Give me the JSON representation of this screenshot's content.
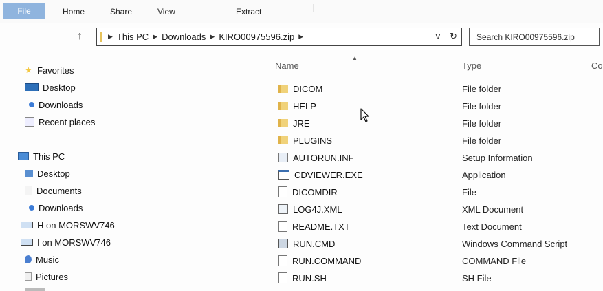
{
  "ribbon": {
    "tabs": [
      "File",
      "Home",
      "Share",
      "View",
      "Extract"
    ]
  },
  "address": {
    "crumbs": [
      "This PC",
      "Downloads",
      "KIRO00975596.zip"
    ],
    "dropdown_glyph": "v",
    "refresh_glyph": "↻"
  },
  "search": {
    "placeholder": "Search KIRO00975596.zip"
  },
  "nav": {
    "items": [
      {
        "label": "Favorites",
        "icon": "star-icon"
      },
      {
        "label": "Desktop",
        "icon": "desktop-icon"
      },
      {
        "label": "Downloads",
        "icon": "downloads-icon"
      },
      {
        "label": "Recent places",
        "icon": "recent-places-icon"
      },
      {
        "label": "This PC",
        "icon": "computer-icon"
      },
      {
        "label": "Desktop",
        "icon": "desktop-icon"
      },
      {
        "label": "Documents",
        "icon": "documents-icon"
      },
      {
        "label": "Downloads",
        "icon": "downloads-icon"
      },
      {
        "label": "H on MORSWV746",
        "icon": "network-drive-icon"
      },
      {
        "label": "I on MORSWV746",
        "icon": "network-drive-icon"
      },
      {
        "label": "Music",
        "icon": "music-icon"
      },
      {
        "label": "Pictures",
        "icon": "pictures-icon"
      }
    ]
  },
  "columns": {
    "name": "Name",
    "type": "Type",
    "partial": "Co"
  },
  "files": [
    {
      "name": "DICOM",
      "type": "File folder",
      "icon": "folder-icon"
    },
    {
      "name": "HELP",
      "type": "File folder",
      "icon": "folder-icon"
    },
    {
      "name": "JRE",
      "type": "File folder",
      "icon": "folder-icon"
    },
    {
      "name": "PLUGINS",
      "type": "File folder",
      "icon": "folder-icon"
    },
    {
      "name": "AUTORUN.INF",
      "type": "Setup Information",
      "icon": "setup-file-icon"
    },
    {
      "name": "CDVIEWER.EXE",
      "type": "Application",
      "icon": "application-icon"
    },
    {
      "name": "DICOMDIR",
      "type": "File",
      "icon": "file-icon"
    },
    {
      "name": "LOG4J.XML",
      "type": "XML Document",
      "icon": "xml-file-icon"
    },
    {
      "name": "README.TXT",
      "type": "Text Document",
      "icon": "file-icon"
    },
    {
      "name": "RUN.CMD",
      "type": "Windows Command Script",
      "icon": "cmd-file-icon"
    },
    {
      "name": "RUN.COMMAND",
      "type": "COMMAND File",
      "icon": "file-icon"
    },
    {
      "name": "RUN.SH",
      "type": "SH File",
      "icon": "file-icon"
    }
  ]
}
